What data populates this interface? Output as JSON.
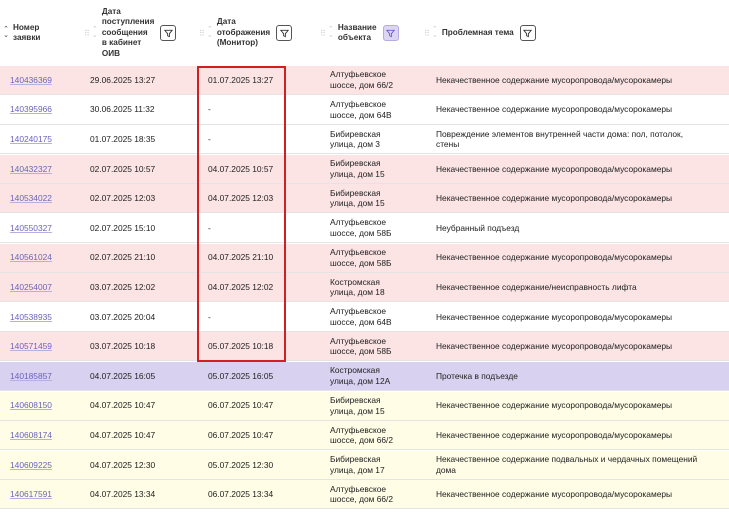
{
  "header": {
    "col_number": [
      "Номер",
      "заявки"
    ],
    "col_received": [
      "Дата",
      "поступления",
      "сообщения",
      "в кабинет",
      "ОИВ"
    ],
    "col_display": [
      "Дата",
      "отображения",
      "(Монитор)"
    ],
    "col_object": [
      "Название",
      "объекта"
    ],
    "col_topic": [
      "Проблемная тема"
    ]
  },
  "rows": [
    {
      "number": "140436369",
      "received": "29.06.2025 13:27",
      "display": "01.07.2025 13:27",
      "object": [
        "Алтуфьевское",
        "шоссе, дом 66/2"
      ],
      "topic": [
        "Некачественное содержание мусоропровода/мусорокамеры"
      ],
      "tone": "pink"
    },
    {
      "number": "140395966",
      "received": "30.06.2025 11:32",
      "display": "-",
      "object": [
        "Алтуфьевское",
        "шоссе, дом 64В"
      ],
      "topic": [
        "Некачественное содержание мусоропровода/мусорокамеры"
      ],
      "tone": "white"
    },
    {
      "number": "140240175",
      "received": "01.07.2025 18:35",
      "display": "-",
      "object": [
        "Бибиревская",
        "улица, дом 3"
      ],
      "topic": [
        "Повреждение элементов внутренней части дома: пол, потолок,",
        "стены"
      ],
      "tone": "white"
    },
    {
      "number": "140432327",
      "received": "02.07.2025 10:57",
      "display": "04.07.2025 10:57",
      "object": [
        "Бибиревская",
        "улица, дом 15"
      ],
      "topic": [
        "Некачественное содержание мусоропровода/мусорокамеры"
      ],
      "tone": "pink"
    },
    {
      "number": "140534022",
      "received": "02.07.2025 12:03",
      "display": "04.07.2025 12:03",
      "object": [
        "Бибиревская",
        "улица, дом 15"
      ],
      "topic": [
        "Некачественное содержание мусоропровода/мусорокамеры"
      ],
      "tone": "pink"
    },
    {
      "number": "140550327",
      "received": "02.07.2025 15:10",
      "display": "-",
      "object": [
        "Алтуфьевское",
        "шоссе, дом 58Б"
      ],
      "topic": [
        "Неубранный подъезд"
      ],
      "tone": "white"
    },
    {
      "number": "140561024",
      "received": "02.07.2025 21:10",
      "display": "04.07.2025 21:10",
      "object": [
        "Алтуфьевское",
        "шоссе, дом 58Б"
      ],
      "topic": [
        "Некачественное содержание мусоропровода/мусорокамеры"
      ],
      "tone": "pink"
    },
    {
      "number": "140254007",
      "received": "03.07.2025 12:02",
      "display": "04.07.2025 12:02",
      "object": [
        "Костромская",
        "улица, дом 18"
      ],
      "topic": [
        "Некачественное содержание/неисправность лифта"
      ],
      "tone": "pink"
    },
    {
      "number": "140538935",
      "received": "03.07.2025 20:04",
      "display": "-",
      "object": [
        "Алтуфьевское",
        "шоссе, дом 64В"
      ],
      "topic": [
        "Некачественное содержание мусоропровода/мусорокамеры"
      ],
      "tone": "white"
    },
    {
      "number": "140571459",
      "received": "03.07.2025 10:18",
      "display": "05.07.2025 10:18",
      "object": [
        "Алтуфьевское",
        "шоссе, дом 58Б"
      ],
      "topic": [
        "Некачественное содержание мусоропровода/мусорокамеры"
      ],
      "tone": "pink"
    },
    {
      "number": "140185857",
      "received": "04.07.2025 16:05",
      "display": "05.07.2025 16:05",
      "object": [
        "Костромская",
        "улица, дом 12А"
      ],
      "topic": [
        "Протечка в подъезде"
      ],
      "tone": "purple"
    },
    {
      "number": "140608150",
      "received": "04.07.2025 10:47",
      "display": "06.07.2025 10:47",
      "object": [
        "Бибиревская",
        "улица, дом 15"
      ],
      "topic": [
        "Некачественное содержание мусоропровода/мусорокамеры"
      ],
      "tone": "yellow"
    },
    {
      "number": "140608174",
      "received": "04.07.2025 10:47",
      "display": "06.07.2025 10:47",
      "object": [
        "Алтуфьевское",
        "шоссе, дом 66/2"
      ],
      "topic": [
        "Некачественное содержание мусоропровода/мусорокамеры"
      ],
      "tone": "yellow"
    },
    {
      "number": "140609225",
      "received": "04.07.2025 12:30",
      "display": "05.07.2025 12:30",
      "object": [
        "Бибиревская",
        "улица, дом 17"
      ],
      "topic": [
        "Некачественное содержание подвальных и чердачных помещений",
        "дома"
      ],
      "tone": "yellow"
    },
    {
      "number": "140617591",
      "received": "04.07.2025 13:34",
      "display": "06.07.2025 13:34",
      "object": [
        "Алтуфьевское",
        "шоссе, дом 66/2"
      ],
      "topic": [
        "Некачественное содержание мусоропровода/мусорокамеры"
      ],
      "tone": "yellow"
    }
  ],
  "colors": {
    "pink": "#fce4e5",
    "white": "#ffffff",
    "purple": "#d8d1ef",
    "yellow": "#fffde6",
    "link": "#6a63b8",
    "highlight": "#d21f1f"
  },
  "icons": {
    "filter": "filter-icon",
    "sort": "sort-arrows-icon",
    "grip": "drag-handle-icon"
  }
}
